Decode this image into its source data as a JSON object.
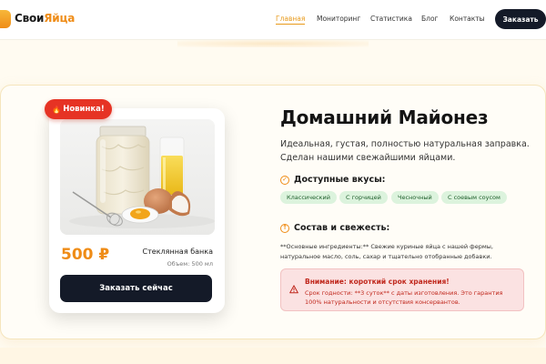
{
  "brand": {
    "name_part1": "Свои",
    "name_part2": "Яйца"
  },
  "nav": {
    "items": [
      {
        "label": "Главная",
        "active": true
      },
      {
        "label": "Мониторинг",
        "active": false
      },
      {
        "label": "Статистика",
        "active": false
      },
      {
        "label": "Блог",
        "active": false
      },
      {
        "label": "Контакты",
        "active": false
      }
    ],
    "order_button": "Заказать"
  },
  "product": {
    "badge": "Новинка!",
    "badge_icon": "fire-icon",
    "price": "500 ₽",
    "name": "Стеклянная банка",
    "volume": "Объем: 500 мл",
    "buy_button": "Заказать сейчас",
    "photo": "mayonnaise-jar-eggs-oil-photo"
  },
  "details": {
    "title": "Домашний Майонез",
    "subtitle": "Идеальная, густая, полностью натуральная заправка. Сделан нашими свежайшими яйцами.",
    "flavors_heading": "Доступные вкусы:",
    "flavors": [
      "Классический",
      "С горчицей",
      "Чесночный",
      "С соевым соусом"
    ],
    "composition_heading": "Состав и свежесть:",
    "ingredients_text": "**Основные ингредиенты:** Свежие куриные яйца с нашей фермы, натуральное масло, соль, сахар и тщательно отобранные добавки.",
    "warning": {
      "title": "Внимание: короткий срок хранения!",
      "text": "Срок годности: **3 суток** с даты изготовления. Это гарантия 100% натуральности и отсутствия консервантов."
    }
  },
  "colors": {
    "accent": "#ef8c17",
    "dark": "#141a28",
    "badge_red": "#e63324",
    "tag_green": "#dcf3dd",
    "warning_red": "#c0281d",
    "band_cream": "#fffbf1"
  }
}
